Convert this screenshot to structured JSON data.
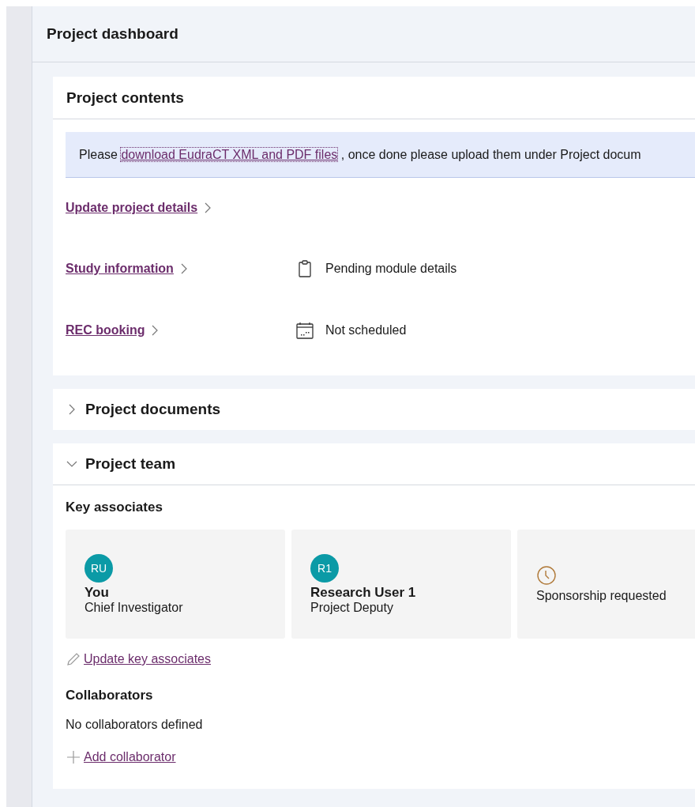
{
  "page": {
    "title": "Project dashboard"
  },
  "contents": {
    "title": "Project contents",
    "notice": {
      "before": "Please",
      "link": "download EudraCT XML and PDF files",
      "after": ", once done please upload them under Project docum"
    },
    "links": [
      {
        "label": "Update project details"
      },
      {
        "label": "Study information",
        "status": "Pending module details",
        "kind": "clipboard"
      },
      {
        "label": "REC booking",
        "status": "Not scheduled",
        "kind": "calendar"
      }
    ]
  },
  "sections": [
    {
      "title": "Project documents",
      "expanded": false
    },
    {
      "title": "Project team",
      "expanded": true
    }
  ],
  "team": {
    "key_associates_title": "Key associates",
    "associates": [
      {
        "kind": "person",
        "initials": "RU",
        "name": "You",
        "role": "Chief Investigator"
      },
      {
        "kind": "person",
        "initials": "R1",
        "name": "Research User 1",
        "role": "Project Deputy"
      },
      {
        "kind": "pending",
        "status": "Sponsorship requested"
      }
    ],
    "update_link": "Update key associates",
    "collaborators_title": "Collaborators",
    "collaborators_empty": "No collaborators defined",
    "add_link": "Add collaborator"
  }
}
